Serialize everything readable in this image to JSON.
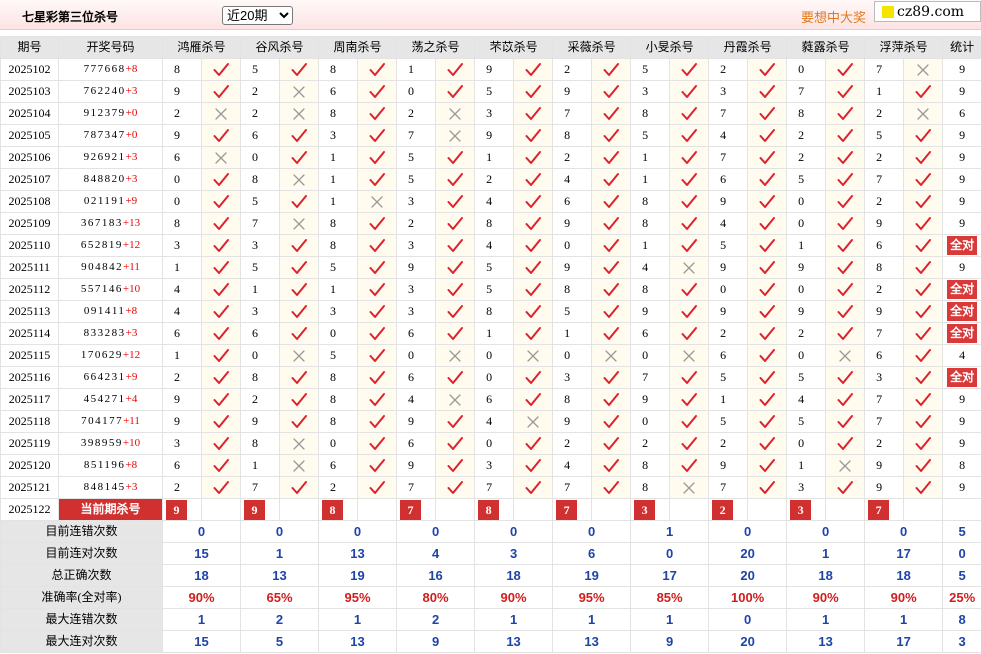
{
  "header": {
    "title": "七星彩第三位杀号",
    "period_select": "近20期",
    "promo": "要想中大奖",
    "logo": "cz89.com"
  },
  "columns": {
    "period": "期号",
    "numbers": "开奖号码",
    "experts": [
      "鸿雁杀号",
      "谷风杀号",
      "周南杀号",
      "荡之杀号",
      "芣苡杀号",
      "采薇杀号",
      "小旻杀号",
      "丹霞杀号",
      "蕤露杀号",
      "浮萍杀号"
    ],
    "stats": "统计"
  },
  "all_right_label": "全对",
  "rows": [
    {
      "period": "2025102",
      "numbers": "777668",
      "plus": "+8",
      "kills": [
        [
          8,
          1
        ],
        [
          5,
          1
        ],
        [
          8,
          1
        ],
        [
          1,
          1
        ],
        [
          9,
          1
        ],
        [
          2,
          1
        ],
        [
          5,
          1
        ],
        [
          2,
          1
        ],
        [
          0,
          1
        ],
        [
          7,
          0
        ]
      ],
      "total": "9"
    },
    {
      "period": "2025103",
      "numbers": "762240",
      "plus": "+3",
      "kills": [
        [
          9,
          1
        ],
        [
          2,
          0
        ],
        [
          6,
          1
        ],
        [
          0,
          1
        ],
        [
          5,
          1
        ],
        [
          9,
          1
        ],
        [
          3,
          1
        ],
        [
          3,
          1
        ],
        [
          7,
          1
        ],
        [
          1,
          1
        ]
      ],
      "total": "9"
    },
    {
      "period": "2025104",
      "numbers": "912379",
      "plus": "+0",
      "kills": [
        [
          2,
          0
        ],
        [
          2,
          0
        ],
        [
          8,
          1
        ],
        [
          2,
          0
        ],
        [
          3,
          1
        ],
        [
          7,
          1
        ],
        [
          8,
          1
        ],
        [
          7,
          1
        ],
        [
          8,
          1
        ],
        [
          2,
          0
        ]
      ],
      "total": "6"
    },
    {
      "period": "2025105",
      "numbers": "787347",
      "plus": "+0",
      "kills": [
        [
          9,
          1
        ],
        [
          6,
          1
        ],
        [
          3,
          1
        ],
        [
          7,
          0
        ],
        [
          9,
          1
        ],
        [
          8,
          1
        ],
        [
          5,
          1
        ],
        [
          4,
          1
        ],
        [
          2,
          1
        ],
        [
          5,
          1
        ]
      ],
      "total": "9"
    },
    {
      "period": "2025106",
      "numbers": "926921",
      "plus": "+3",
      "kills": [
        [
          6,
          0
        ],
        [
          0,
          1
        ],
        [
          1,
          1
        ],
        [
          5,
          1
        ],
        [
          1,
          1
        ],
        [
          2,
          1
        ],
        [
          1,
          1
        ],
        [
          7,
          1
        ],
        [
          2,
          1
        ],
        [
          2,
          1
        ]
      ],
      "total": "9"
    },
    {
      "period": "2025107",
      "numbers": "848820",
      "plus": "+3",
      "kills": [
        [
          0,
          1
        ],
        [
          8,
          0
        ],
        [
          1,
          1
        ],
        [
          5,
          1
        ],
        [
          2,
          1
        ],
        [
          4,
          1
        ],
        [
          1,
          1
        ],
        [
          6,
          1
        ],
        [
          5,
          1
        ],
        [
          7,
          1
        ]
      ],
      "total": "9"
    },
    {
      "period": "2025108",
      "numbers": "021191",
      "plus": "+9",
      "kills": [
        [
          0,
          1
        ],
        [
          5,
          1
        ],
        [
          1,
          0
        ],
        [
          3,
          1
        ],
        [
          4,
          1
        ],
        [
          6,
          1
        ],
        [
          8,
          1
        ],
        [
          9,
          1
        ],
        [
          0,
          1
        ],
        [
          2,
          1
        ]
      ],
      "total": "9"
    },
    {
      "period": "2025109",
      "numbers": "367183",
      "plus": "+13",
      "kills": [
        [
          8,
          1
        ],
        [
          7,
          0
        ],
        [
          8,
          1
        ],
        [
          2,
          1
        ],
        [
          8,
          1
        ],
        [
          9,
          1
        ],
        [
          8,
          1
        ],
        [
          4,
          1
        ],
        [
          0,
          1
        ],
        [
          9,
          1
        ]
      ],
      "total": "9"
    },
    {
      "period": "2025110",
      "numbers": "652819",
      "plus": "+12",
      "kills": [
        [
          3,
          1
        ],
        [
          3,
          1
        ],
        [
          8,
          1
        ],
        [
          3,
          1
        ],
        [
          4,
          1
        ],
        [
          0,
          1
        ],
        [
          1,
          1
        ],
        [
          5,
          1
        ],
        [
          1,
          1
        ],
        [
          6,
          1
        ]
      ],
      "total": "全对"
    },
    {
      "period": "2025111",
      "numbers": "904842",
      "plus": "+11",
      "kills": [
        [
          1,
          1
        ],
        [
          5,
          1
        ],
        [
          5,
          1
        ],
        [
          9,
          1
        ],
        [
          5,
          1
        ],
        [
          9,
          1
        ],
        [
          4,
          0
        ],
        [
          9,
          1
        ],
        [
          9,
          1
        ],
        [
          8,
          1
        ]
      ],
      "total": "9"
    },
    {
      "period": "2025112",
      "numbers": "557146",
      "plus": "+10",
      "kills": [
        [
          4,
          1
        ],
        [
          1,
          1
        ],
        [
          1,
          1
        ],
        [
          3,
          1
        ],
        [
          5,
          1
        ],
        [
          8,
          1
        ],
        [
          8,
          1
        ],
        [
          0,
          1
        ],
        [
          0,
          1
        ],
        [
          2,
          1
        ]
      ],
      "total": "全对"
    },
    {
      "period": "2025113",
      "numbers": "091411",
      "plus": "+8",
      "kills": [
        [
          4,
          1
        ],
        [
          3,
          1
        ],
        [
          3,
          1
        ],
        [
          3,
          1
        ],
        [
          8,
          1
        ],
        [
          5,
          1
        ],
        [
          9,
          1
        ],
        [
          9,
          1
        ],
        [
          9,
          1
        ],
        [
          9,
          1
        ]
      ],
      "total": "全对"
    },
    {
      "period": "2025114",
      "numbers": "833283",
      "plus": "+3",
      "kills": [
        [
          6,
          1
        ],
        [
          6,
          1
        ],
        [
          0,
          1
        ],
        [
          6,
          1
        ],
        [
          1,
          1
        ],
        [
          1,
          1
        ],
        [
          6,
          1
        ],
        [
          2,
          1
        ],
        [
          2,
          1
        ],
        [
          7,
          1
        ]
      ],
      "total": "全对"
    },
    {
      "period": "2025115",
      "numbers": "170629",
      "plus": "+12",
      "kills": [
        [
          1,
          1
        ],
        [
          0,
          0
        ],
        [
          5,
          1
        ],
        [
          0,
          0
        ],
        [
          0,
          0
        ],
        [
          0,
          0
        ],
        [
          0,
          0
        ],
        [
          6,
          1
        ],
        [
          0,
          0
        ],
        [
          6,
          1
        ]
      ],
      "total": "4"
    },
    {
      "period": "2025116",
      "numbers": "664231",
      "plus": "+9",
      "kills": [
        [
          2,
          1
        ],
        [
          8,
          1
        ],
        [
          8,
          1
        ],
        [
          6,
          1
        ],
        [
          0,
          1
        ],
        [
          3,
          1
        ],
        [
          7,
          1
        ],
        [
          5,
          1
        ],
        [
          5,
          1
        ],
        [
          3,
          1
        ]
      ],
      "total": "全对"
    },
    {
      "period": "2025117",
      "numbers": "454271",
      "plus": "+4",
      "kills": [
        [
          9,
          1
        ],
        [
          2,
          1
        ],
        [
          8,
          1
        ],
        [
          4,
          0
        ],
        [
          6,
          1
        ],
        [
          8,
          1
        ],
        [
          9,
          1
        ],
        [
          1,
          1
        ],
        [
          4,
          1
        ],
        [
          7,
          1
        ]
      ],
      "total": "9"
    },
    {
      "period": "2025118",
      "numbers": "704177",
      "plus": "+11",
      "kills": [
        [
          9,
          1
        ],
        [
          9,
          1
        ],
        [
          8,
          1
        ],
        [
          9,
          1
        ],
        [
          4,
          0
        ],
        [
          9,
          1
        ],
        [
          0,
          1
        ],
        [
          5,
          1
        ],
        [
          5,
          1
        ],
        [
          7,
          1
        ]
      ],
      "total": "9"
    },
    {
      "period": "2025119",
      "numbers": "398959",
      "plus": "+10",
      "kills": [
        [
          3,
          1
        ],
        [
          8,
          0
        ],
        [
          0,
          1
        ],
        [
          6,
          1
        ],
        [
          0,
          1
        ],
        [
          2,
          1
        ],
        [
          2,
          1
        ],
        [
          2,
          1
        ],
        [
          0,
          1
        ],
        [
          2,
          1
        ]
      ],
      "total": "9"
    },
    {
      "period": "2025120",
      "numbers": "851196",
      "plus": "+8",
      "kills": [
        [
          6,
          1
        ],
        [
          1,
          0
        ],
        [
          6,
          1
        ],
        [
          9,
          1
        ],
        [
          3,
          1
        ],
        [
          4,
          1
        ],
        [
          8,
          1
        ],
        [
          9,
          1
        ],
        [
          1,
          0
        ],
        [
          9,
          1
        ]
      ],
      "total": "8"
    },
    {
      "period": "2025121",
      "numbers": "848145",
      "plus": "+3",
      "kills": [
        [
          2,
          1
        ],
        [
          7,
          1
        ],
        [
          2,
          1
        ],
        [
          7,
          1
        ],
        [
          7,
          1
        ],
        [
          7,
          1
        ],
        [
          8,
          0
        ],
        [
          7,
          1
        ],
        [
          3,
          1
        ],
        [
          9,
          1
        ]
      ],
      "total": "9"
    }
  ],
  "current": {
    "period": "2025122",
    "label": "当前期杀号",
    "kills": [
      "9",
      "9",
      "8",
      "7",
      "8",
      "7",
      "3",
      "2",
      "3",
      "7"
    ]
  },
  "stats": [
    {
      "label": "目前连错次数",
      "values": [
        "0",
        "0",
        "0",
        "0",
        "0",
        "0",
        "1",
        "0",
        "0",
        "0"
      ],
      "total": "5"
    },
    {
      "label": "目前连对次数",
      "values": [
        "15",
        "1",
        "13",
        "4",
        "3",
        "6",
        "0",
        "20",
        "1",
        "17"
      ],
      "total": "0"
    },
    {
      "label": "总正确次数",
      "values": [
        "18",
        "13",
        "19",
        "16",
        "18",
        "19",
        "17",
        "20",
        "18",
        "18"
      ],
      "total": "5"
    },
    {
      "label": "准确率(全对率)",
      "values": [
        "90%",
        "65%",
        "95%",
        "80%",
        "90%",
        "95%",
        "85%",
        "100%",
        "90%",
        "90%"
      ],
      "total": "25%",
      "is_rate": true
    },
    {
      "label": "最大连错次数",
      "values": [
        "1",
        "2",
        "1",
        "2",
        "1",
        "1",
        "1",
        "0",
        "1",
        "1"
      ],
      "total": "8"
    },
    {
      "label": "最大连对次数",
      "values": [
        "15",
        "5",
        "13",
        "9",
        "13",
        "13",
        "9",
        "20",
        "13",
        "17"
      ],
      "total": "3"
    }
  ],
  "icons": {
    "right": "check-icon",
    "wrong": "cross-icon"
  },
  "colors": {
    "check": "#e0202b",
    "cross": "#9a9a9a",
    "header_bg": "#e6e6e6",
    "kill_badge": "#d03030",
    "stat_value": "#1f44a8",
    "rate": "#d21d1d",
    "plus": "#e00000",
    "promo": "#e2781e"
  }
}
